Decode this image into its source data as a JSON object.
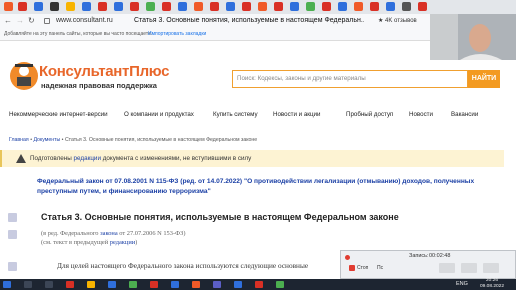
{
  "browser": {
    "url": "www.consultant.ru",
    "tab_title": "Статья 3. Основные понятия, используемые в настоящем Федеральн...",
    "review_badge": "★ 4K отзывов",
    "bookmarks_hint": "Добавляйте на эту панель сайты, которые вы часто посещаете.",
    "bookmarks_link": "Импортировать закладки"
  },
  "header": {
    "logo_line1": "КонсультантПлюс",
    "logo_line2": "надежная правовая поддержка",
    "search_placeholder": "Поиск: Кодексы, законы и другие материалы",
    "search_button": "НАЙТИ"
  },
  "nav": {
    "items": [
      "Некоммерческие интернет-версии",
      "О компании и продуктах",
      "Купить систему",
      "Новости и акции",
      "Пробный доступ",
      "Новости",
      "Вакансии"
    ]
  },
  "breadcrumbs": [
    "Главная",
    "Документы",
    "Статья 3. Основные понятия, используемые в настоящем Федеральном законе"
  ],
  "notice": {
    "text_before": "Подготовлены ",
    "link": "редакции",
    "text_after": " документа с изменениями, не вступившими в силу"
  },
  "document": {
    "law_title": "Федеральный закон от 07.08.2001 N 115-ФЗ (ред. от 14.07.2022) \"О противодействии легализации (отмыванию) доходов, полученных преступным путем, и финансированию терроризма\"",
    "article_title": "Статья 3. Основные понятия, используемые в настоящем Федеральном законе",
    "meta_line1_before": "(в ред. Федерального ",
    "meta_line1_link": "закона",
    "meta_line1_after": " от 27.07.2006 N 153-ФЗ)",
    "meta_line2_before": "(см. текст в предыдущей ",
    "meta_line2_link": "редакции",
    "meta_line2_after": ")",
    "paragraph": "Для целей настоящего Федерального закона используются следующие основные"
  },
  "recorder": {
    "label": "Запись:",
    "time": "00:02:48",
    "stop": "Стоп",
    "pause": "Пс"
  },
  "taskbar": {
    "lang": "ENG",
    "time": "20:26",
    "date": "09.08.2022"
  },
  "colors": {
    "accent": "#f39a21",
    "link": "#1a3fa5",
    "notice_bg": "#fdf3d3"
  }
}
